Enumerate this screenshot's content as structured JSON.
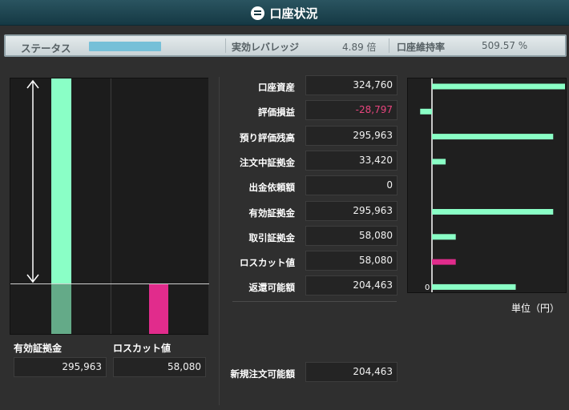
{
  "title": "口座状況",
  "status_bar": {
    "status_label": "ステータス",
    "status_level": 1.0,
    "leverage_label": "実効レバレッジ",
    "leverage_value": "4.89 倍",
    "margin_rate_label": "口座維持率",
    "margin_rate_value": "509.57 %"
  },
  "left_panel": {
    "effective_label": "有効証拠金",
    "effective_value": "295,963",
    "losscut_label": "ロスカット値",
    "losscut_value": "58,080"
  },
  "rows": [
    {
      "label": "口座資産",
      "value": "324,760"
    },
    {
      "label": "評価損益",
      "value": "-28,797"
    },
    {
      "label": "預り評価残高",
      "value": "295,963"
    },
    {
      "label": "注文中証拠金",
      "value": "33,420"
    },
    {
      "label": "出金依頼額",
      "value": "0"
    },
    {
      "label": "有効証拠金",
      "value": "295,963"
    },
    {
      "label": "取引証拠金",
      "value": "58,080"
    },
    {
      "label": "ロスカット値",
      "value": "58,080"
    },
    {
      "label": "返還可能額",
      "value": "204,463"
    }
  ],
  "new_order": {
    "label": "新規注文可能額",
    "value": "204,463"
  },
  "chart_data": {
    "type": "bar",
    "categories": [
      "口座資産",
      "評価損益",
      "預り評価残高",
      "注文中証拠金",
      "出金依頼額",
      "有効証拠金",
      "取引証拠金",
      "ロスカット値",
      "返還可能額"
    ],
    "values": [
      324760,
      -28797,
      295963,
      33420,
      0,
      295963,
      58080,
      58080,
      204463
    ],
    "colors": [
      "#8affc6",
      "#8affc6",
      "#8affc6",
      "#8affc6",
      "#8affc6",
      "#8affc6",
      "#8affc6",
      "#e12c8c",
      "#8affc6"
    ],
    "zero_label": "0",
    "unit": "単位（円）"
  }
}
